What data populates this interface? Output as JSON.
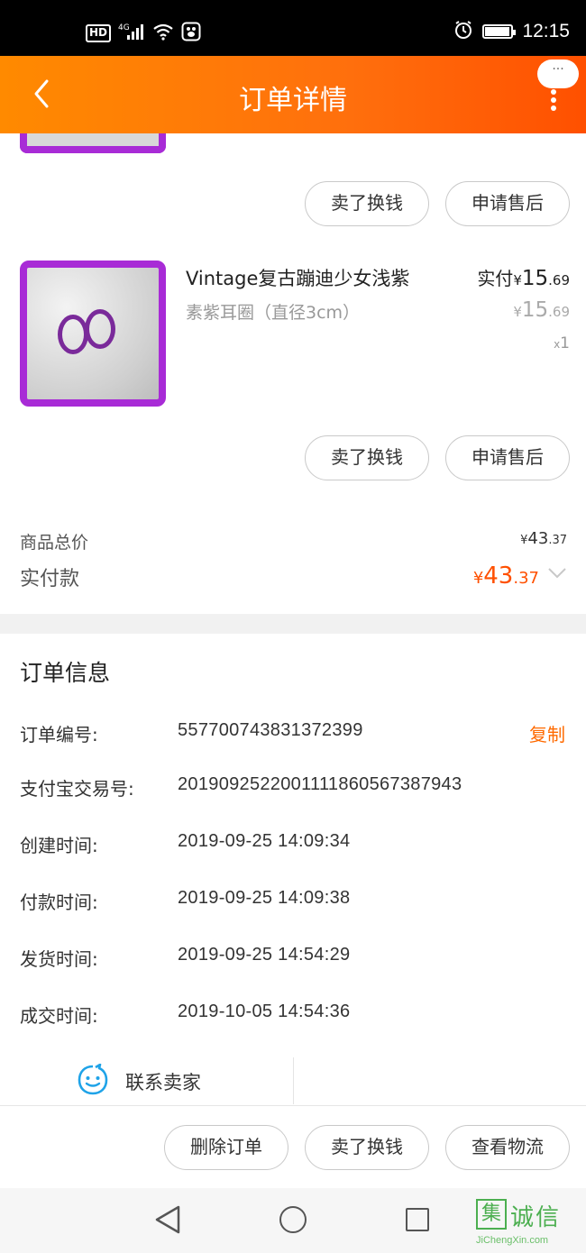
{
  "status_bar": {
    "hd_label": "HD",
    "network_label": "4G",
    "time": "12:15",
    "battery_level": 0.9
  },
  "header": {
    "title": "订单详情",
    "bubble_label": "···"
  },
  "item1_actions": {
    "sell": "卖了换钱",
    "after_sale": "申请售后"
  },
  "product": {
    "title": "Vintage复古蹦迪少女浅紫",
    "sku": "素紫耳圈（直径3cm）",
    "paid_prefix": "实付",
    "currency": "¥",
    "paid_int": "15",
    "paid_dec": ".69",
    "orig_int": "15",
    "orig_dec": ".69",
    "qty_x": "x",
    "qty": "1"
  },
  "item2_actions": {
    "sell": "卖了换钱",
    "after_sale": "申请售后"
  },
  "totals": {
    "goods_total_label": "商品总价",
    "goods_total_int": "43",
    "goods_total_dec": ".37",
    "paid_label": "实付款",
    "paid_int": "43",
    "paid_dec": ".37",
    "currency": "¥"
  },
  "order_info": {
    "title": "订单信息",
    "copy_label": "复制",
    "rows": [
      {
        "label": "订单编号:",
        "value": "557700743831372399"
      },
      {
        "label": "支付宝交易号:",
        "value": "2019092522001111860567387943"
      },
      {
        "label": "创建时间:",
        "value": "2019-09-25 14:09:34"
      },
      {
        "label": "付款时间:",
        "value": "2019-09-25 14:09:38"
      },
      {
        "label": "发货时间:",
        "value": "2019-09-25 14:54:29"
      },
      {
        "label": "成交时间:",
        "value": "2019-10-05 14:54:36"
      }
    ]
  },
  "contact": {
    "label": "联系卖家"
  },
  "footer_actions": {
    "delete": "删除订单",
    "sell": "卖了换钱",
    "logistics": "查看物流"
  },
  "watermark": {
    "box_char": "集",
    "text": "诚信",
    "url": "JiChengXin.com"
  },
  "colors": {
    "accent": "#ff5000",
    "header_start": "#ff8a00",
    "thumb_border": "#a82bd6"
  }
}
